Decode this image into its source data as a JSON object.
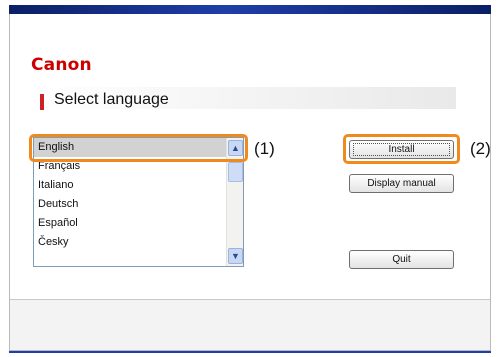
{
  "brand": {
    "logo_text": "Canon"
  },
  "heading": {
    "title": "Select language"
  },
  "language_list": {
    "items": [
      "English",
      "Français",
      "Italiano",
      "Deutsch",
      "Español",
      "Česky",
      ""
    ],
    "selected": "English"
  },
  "buttons": {
    "install": "Install",
    "display_manual": "Display manual",
    "quit": "Quit"
  },
  "callouts": {
    "one": "(1)",
    "two": "(2)"
  },
  "colors": {
    "brand_red": "#cc0000",
    "highlight_orange": "#f08a1c",
    "title_blue": "#1f3fa8"
  },
  "icons": {
    "scroll_up": "chevron-up-icon",
    "scroll_down": "chevron-down-icon"
  }
}
